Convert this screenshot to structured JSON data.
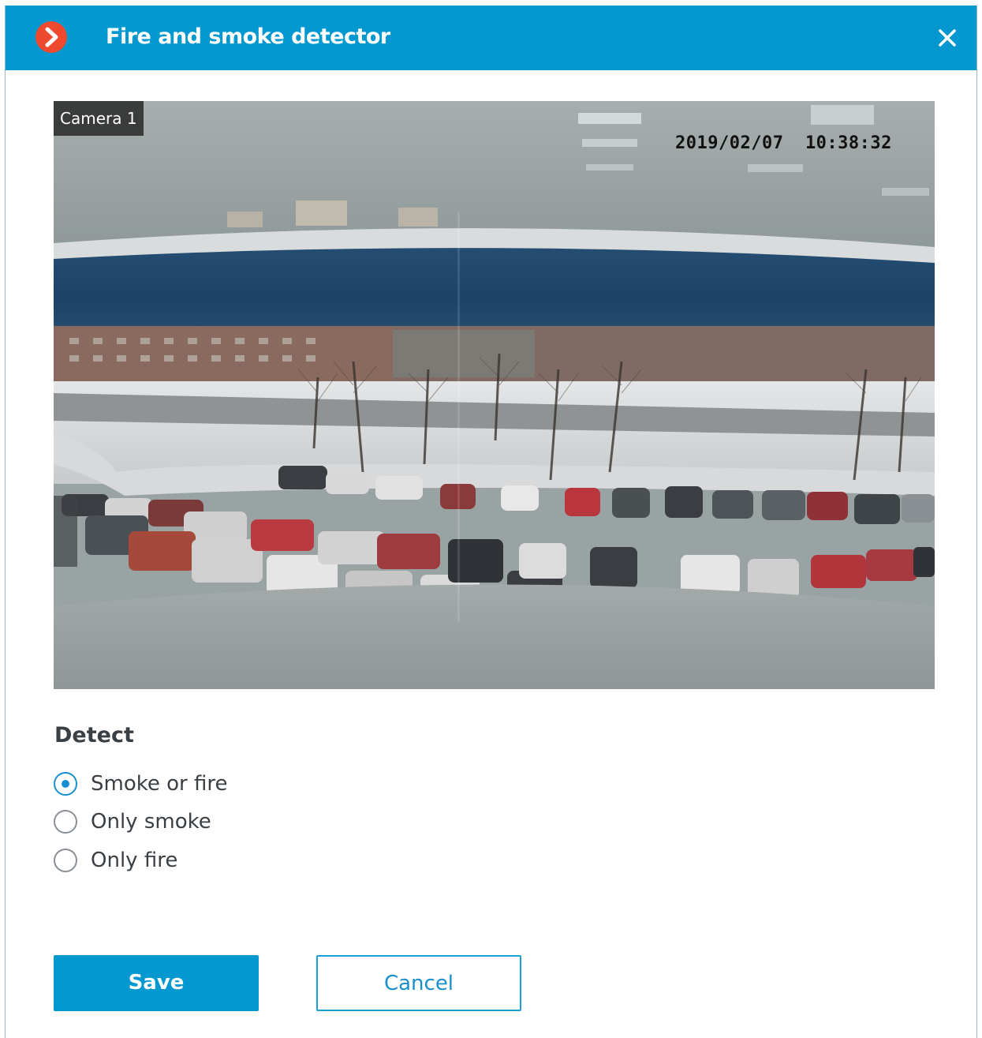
{
  "dialog": {
    "title": "Fire and smoke detector",
    "logo_icon": "chevron-right-logo-icon",
    "close_icon": "close-icon"
  },
  "video": {
    "camera_label": "Camera 1",
    "timestamp_overlay": "2019/02/07  10:38:32"
  },
  "detect": {
    "label": "Detect",
    "options": [
      {
        "label": "Smoke or fire",
        "checked": true
      },
      {
        "label": "Only smoke",
        "checked": false
      },
      {
        "label": "Only fire",
        "checked": false
      }
    ]
  },
  "buttons": {
    "save_label": "Save",
    "cancel_label": "Cancel"
  },
  "colors": {
    "accent": "#0498d0",
    "logo": "#ef4a30",
    "radio_checked": "#1a8fd0"
  }
}
